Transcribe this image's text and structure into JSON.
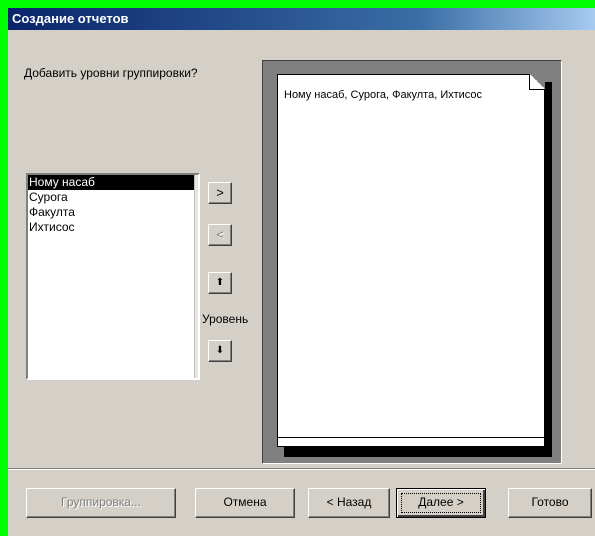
{
  "window": {
    "title": "Создание отчетов"
  },
  "prompt": "Добавить уровни группировки?",
  "fields": {
    "items": [
      "Ному насаб",
      "Сурога",
      "Факулта",
      "Ихтисос"
    ],
    "selected": "Ному насаб"
  },
  "move_buttons": {
    "add": ">",
    "remove": "<",
    "priority_up": "⬆",
    "priority_down": "⬇",
    "level_label": "Уровень"
  },
  "preview": {
    "text": "Ному насаб, Сурога, Факулта, Ихтисос"
  },
  "footer": {
    "grouping": "Группировка...",
    "cancel": "Отмена",
    "back": "< Назад",
    "next": "Далее >",
    "finish": "Готово"
  }
}
